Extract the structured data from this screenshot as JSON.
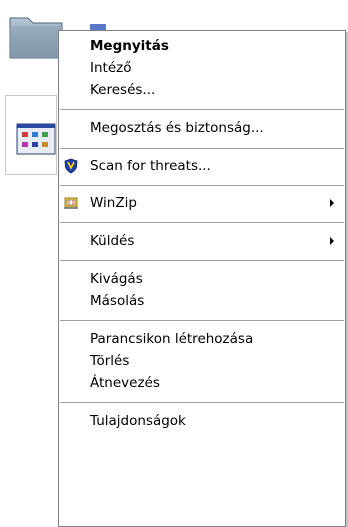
{
  "desktop": {
    "folder_icon": "folder-icon",
    "shortcut_icon": "control-panel-shortcut-icon"
  },
  "context_menu": {
    "items": [
      {
        "label": "Megnyitás",
        "bold": true
      },
      {
        "label": "Intéző"
      },
      {
        "label": "Keresés..."
      },
      {
        "label": "Megosztás és biztonság..."
      },
      {
        "label": "Scan for threats...",
        "icon": "shield-scan-icon"
      },
      {
        "label": "WinZip",
        "icon": "winzip-icon",
        "submenu": true
      },
      {
        "label": "Küldés",
        "submenu": true
      },
      {
        "label": "Kivágás"
      },
      {
        "label": "Másolás"
      },
      {
        "label": "Parancsikon létrehozása"
      },
      {
        "label": "Törlés"
      },
      {
        "label": "Átnevezés"
      },
      {
        "label": "Tulajdonságok"
      }
    ]
  },
  "colors": {
    "menu_background": "#ffffff",
    "menu_border": "#808080",
    "separator": "#a0a0a0",
    "text": "#000000"
  }
}
